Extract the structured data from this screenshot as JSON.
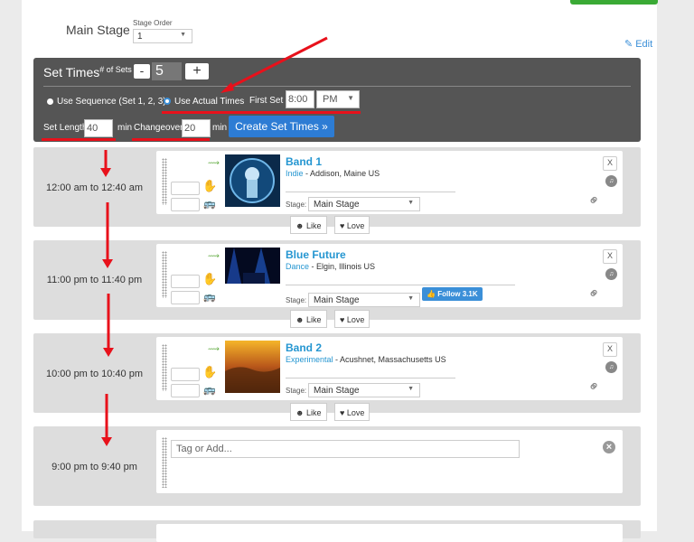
{
  "stage": {
    "name": "Main Stage",
    "order_label": "Stage Order",
    "order_value": "1",
    "edit_label": "Edit"
  },
  "set_times": {
    "title": "Set Times",
    "sets_label": "# of Sets",
    "minus": "-",
    "plus": "+",
    "num_sets": "5",
    "use_sequence": "Use Sequence (Set 1, 2, 3)",
    "use_actual": "Use Actual Times",
    "first_set_label": "First Set",
    "first_set_value": "8:00",
    "ampm": "PM",
    "set_length_label": "Set Length",
    "set_length_value": "40",
    "min": "min",
    "changeover_label": "Changeover",
    "changeover_value": "20",
    "create_button": "Create Set Times »"
  },
  "rows": [
    {
      "time": "12:00 am to 12:40 am",
      "band": "Band 1",
      "genre": "Indie",
      "location": " - Addison, Maine US",
      "stage_label": "Stage:",
      "stage": "Main Stage"
    },
    {
      "time": "11:00 pm to 11:40 pm",
      "band": "Blue Future",
      "genre": "Dance",
      "location": " - Elgin, Illinois US",
      "stage_label": "Stage:",
      "stage": "Main Stage",
      "follow": "Follow 3.1K"
    },
    {
      "time": "10:00 pm to 10:40 pm",
      "band": "Band 2",
      "genre": "Experimental",
      "location": " - Acushnet, Massachusetts US",
      "stage_label": "Stage:",
      "stage": "Main Stage"
    },
    {
      "time": "9:00 pm to 9:40 pm",
      "tag_placeholder": "Tag or Add..."
    }
  ],
  "reactions": {
    "like": "Like",
    "love": "Love"
  },
  "remove_label": "X",
  "icons": {
    "leaf": "leaf-icon",
    "hand": "hand-icon",
    "bus": "bus-icon",
    "music": "music-icon",
    "link": "link-icon",
    "smile": "smile-icon",
    "heart": "heart-icon",
    "thumbs_up": "thumbs-up-icon",
    "pencil": "pencil-icon",
    "close": "close-icon"
  },
  "colors": {
    "accent": "#2596d1",
    "panel": "#555555",
    "annotation": "#e8111b",
    "hand": "#e91e63"
  }
}
